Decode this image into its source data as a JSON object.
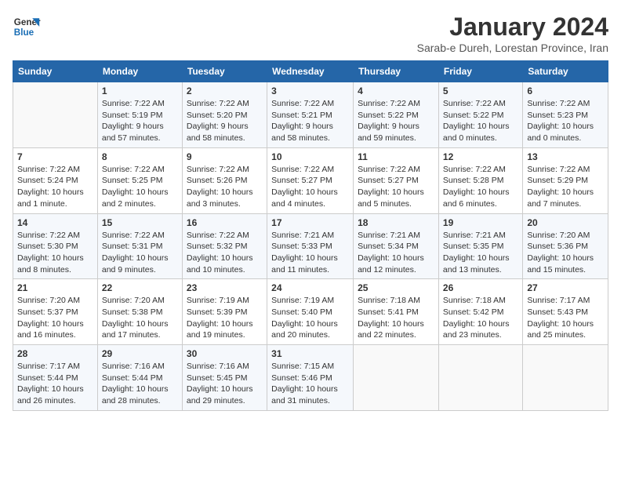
{
  "header": {
    "logo_general": "General",
    "logo_blue": "Blue",
    "month_title": "January 2024",
    "location": "Sarab-e Dureh, Lorestan Province, Iran"
  },
  "weekdays": [
    "Sunday",
    "Monday",
    "Tuesday",
    "Wednesday",
    "Thursday",
    "Friday",
    "Saturday"
  ],
  "weeks": [
    [
      {
        "day": "",
        "sunrise": "",
        "sunset": "",
        "daylight": ""
      },
      {
        "day": "1",
        "sunrise": "Sunrise: 7:22 AM",
        "sunset": "Sunset: 5:19 PM",
        "daylight": "Daylight: 9 hours and 57 minutes."
      },
      {
        "day": "2",
        "sunrise": "Sunrise: 7:22 AM",
        "sunset": "Sunset: 5:20 PM",
        "daylight": "Daylight: 9 hours and 58 minutes."
      },
      {
        "day": "3",
        "sunrise": "Sunrise: 7:22 AM",
        "sunset": "Sunset: 5:21 PM",
        "daylight": "Daylight: 9 hours and 58 minutes."
      },
      {
        "day": "4",
        "sunrise": "Sunrise: 7:22 AM",
        "sunset": "Sunset: 5:22 PM",
        "daylight": "Daylight: 9 hours and 59 minutes."
      },
      {
        "day": "5",
        "sunrise": "Sunrise: 7:22 AM",
        "sunset": "Sunset: 5:22 PM",
        "daylight": "Daylight: 10 hours and 0 minutes."
      },
      {
        "day": "6",
        "sunrise": "Sunrise: 7:22 AM",
        "sunset": "Sunset: 5:23 PM",
        "daylight": "Daylight: 10 hours and 0 minutes."
      }
    ],
    [
      {
        "day": "7",
        "sunrise": "Sunrise: 7:22 AM",
        "sunset": "Sunset: 5:24 PM",
        "daylight": "Daylight: 10 hours and 1 minute."
      },
      {
        "day": "8",
        "sunrise": "Sunrise: 7:22 AM",
        "sunset": "Sunset: 5:25 PM",
        "daylight": "Daylight: 10 hours and 2 minutes."
      },
      {
        "day": "9",
        "sunrise": "Sunrise: 7:22 AM",
        "sunset": "Sunset: 5:26 PM",
        "daylight": "Daylight: 10 hours and 3 minutes."
      },
      {
        "day": "10",
        "sunrise": "Sunrise: 7:22 AM",
        "sunset": "Sunset: 5:27 PM",
        "daylight": "Daylight: 10 hours and 4 minutes."
      },
      {
        "day": "11",
        "sunrise": "Sunrise: 7:22 AM",
        "sunset": "Sunset: 5:27 PM",
        "daylight": "Daylight: 10 hours and 5 minutes."
      },
      {
        "day": "12",
        "sunrise": "Sunrise: 7:22 AM",
        "sunset": "Sunset: 5:28 PM",
        "daylight": "Daylight: 10 hours and 6 minutes."
      },
      {
        "day": "13",
        "sunrise": "Sunrise: 7:22 AM",
        "sunset": "Sunset: 5:29 PM",
        "daylight": "Daylight: 10 hours and 7 minutes."
      }
    ],
    [
      {
        "day": "14",
        "sunrise": "Sunrise: 7:22 AM",
        "sunset": "Sunset: 5:30 PM",
        "daylight": "Daylight: 10 hours and 8 minutes."
      },
      {
        "day": "15",
        "sunrise": "Sunrise: 7:22 AM",
        "sunset": "Sunset: 5:31 PM",
        "daylight": "Daylight: 10 hours and 9 minutes."
      },
      {
        "day": "16",
        "sunrise": "Sunrise: 7:22 AM",
        "sunset": "Sunset: 5:32 PM",
        "daylight": "Daylight: 10 hours and 10 minutes."
      },
      {
        "day": "17",
        "sunrise": "Sunrise: 7:21 AM",
        "sunset": "Sunset: 5:33 PM",
        "daylight": "Daylight: 10 hours and 11 minutes."
      },
      {
        "day": "18",
        "sunrise": "Sunrise: 7:21 AM",
        "sunset": "Sunset: 5:34 PM",
        "daylight": "Daylight: 10 hours and 12 minutes."
      },
      {
        "day": "19",
        "sunrise": "Sunrise: 7:21 AM",
        "sunset": "Sunset: 5:35 PM",
        "daylight": "Daylight: 10 hours and 13 minutes."
      },
      {
        "day": "20",
        "sunrise": "Sunrise: 7:20 AM",
        "sunset": "Sunset: 5:36 PM",
        "daylight": "Daylight: 10 hours and 15 minutes."
      }
    ],
    [
      {
        "day": "21",
        "sunrise": "Sunrise: 7:20 AM",
        "sunset": "Sunset: 5:37 PM",
        "daylight": "Daylight: 10 hours and 16 minutes."
      },
      {
        "day": "22",
        "sunrise": "Sunrise: 7:20 AM",
        "sunset": "Sunset: 5:38 PM",
        "daylight": "Daylight: 10 hours and 17 minutes."
      },
      {
        "day": "23",
        "sunrise": "Sunrise: 7:19 AM",
        "sunset": "Sunset: 5:39 PM",
        "daylight": "Daylight: 10 hours and 19 minutes."
      },
      {
        "day": "24",
        "sunrise": "Sunrise: 7:19 AM",
        "sunset": "Sunset: 5:40 PM",
        "daylight": "Daylight: 10 hours and 20 minutes."
      },
      {
        "day": "25",
        "sunrise": "Sunrise: 7:18 AM",
        "sunset": "Sunset: 5:41 PM",
        "daylight": "Daylight: 10 hours and 22 minutes."
      },
      {
        "day": "26",
        "sunrise": "Sunrise: 7:18 AM",
        "sunset": "Sunset: 5:42 PM",
        "daylight": "Daylight: 10 hours and 23 minutes."
      },
      {
        "day": "27",
        "sunrise": "Sunrise: 7:17 AM",
        "sunset": "Sunset: 5:43 PM",
        "daylight": "Daylight: 10 hours and 25 minutes."
      }
    ],
    [
      {
        "day": "28",
        "sunrise": "Sunrise: 7:17 AM",
        "sunset": "Sunset: 5:44 PM",
        "daylight": "Daylight: 10 hours and 26 minutes."
      },
      {
        "day": "29",
        "sunrise": "Sunrise: 7:16 AM",
        "sunset": "Sunset: 5:44 PM",
        "daylight": "Daylight: 10 hours and 28 minutes."
      },
      {
        "day": "30",
        "sunrise": "Sunrise: 7:16 AM",
        "sunset": "Sunset: 5:45 PM",
        "daylight": "Daylight: 10 hours and 29 minutes."
      },
      {
        "day": "31",
        "sunrise": "Sunrise: 7:15 AM",
        "sunset": "Sunset: 5:46 PM",
        "daylight": "Daylight: 10 hours and 31 minutes."
      },
      {
        "day": "",
        "sunrise": "",
        "sunset": "",
        "daylight": ""
      },
      {
        "day": "",
        "sunrise": "",
        "sunset": "",
        "daylight": ""
      },
      {
        "day": "",
        "sunrise": "",
        "sunset": "",
        "daylight": ""
      }
    ]
  ]
}
